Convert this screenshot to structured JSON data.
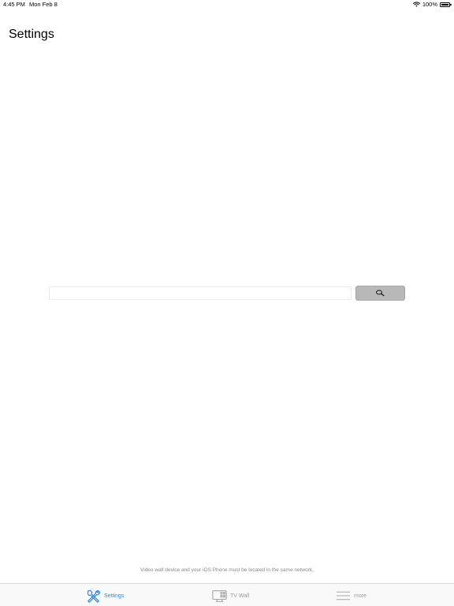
{
  "status_bar": {
    "time": "4:45 PM",
    "date": "Mon Feb 8",
    "battery_percent": "100%",
    "wifi_icon": "wifi-icon",
    "battery_icon": "battery-full-icon"
  },
  "page": {
    "title": "Settings"
  },
  "search": {
    "value": "",
    "placeholder": "",
    "button_icon": "magnifier-icon"
  },
  "footer": {
    "note": "Video wall device and your iOS Phone must be located in the same network."
  },
  "tab_bar": {
    "items": [
      {
        "label": "Settings",
        "icon": "tools-icon",
        "selected": true
      },
      {
        "label": "TV Wall",
        "icon": "tv-wall-icon",
        "selected": false
      },
      {
        "label": "more",
        "icon": "menu-lines-icon",
        "selected": false
      }
    ]
  },
  "colors": {
    "accent": "#2f8ee5",
    "inactive_tab": "#9a9a9a",
    "search_button": "#b8b8b8",
    "note_text": "#8a8a8a"
  }
}
